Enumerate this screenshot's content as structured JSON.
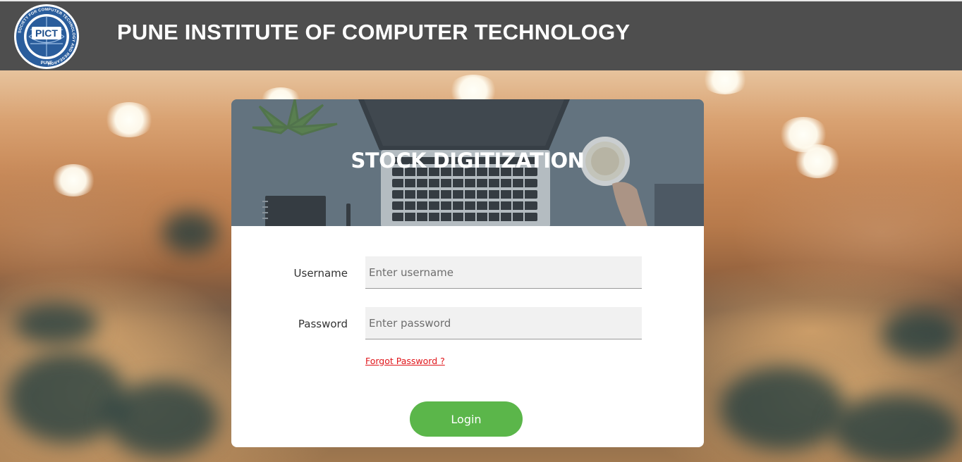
{
  "header": {
    "logo": {
      "icon": "pict-logo-icon",
      "abbreviation": "PICT",
      "ring_text": "SOCIETY FOR COMPUTER TECHNOLOGY AND RESEARCH",
      "city": "PUNE"
    },
    "title": "PUNE INSTITUTE OF COMPUTER TECHNOLOGY",
    "background_color": "#4e4e4e"
  },
  "login_card": {
    "banner_title": "STOCK DIGITIZATION",
    "username": {
      "label": "Username",
      "value": "",
      "placeholder": "Enter username"
    },
    "password": {
      "label": "Password",
      "value": "",
      "placeholder": "Enter password"
    },
    "forgot_password_label": "Forgot Password ?",
    "login_button_label": "Login"
  },
  "colors": {
    "accent_green": "#5bb64a",
    "link_red": "#e0161b",
    "header_gray": "#4e4e4e"
  }
}
